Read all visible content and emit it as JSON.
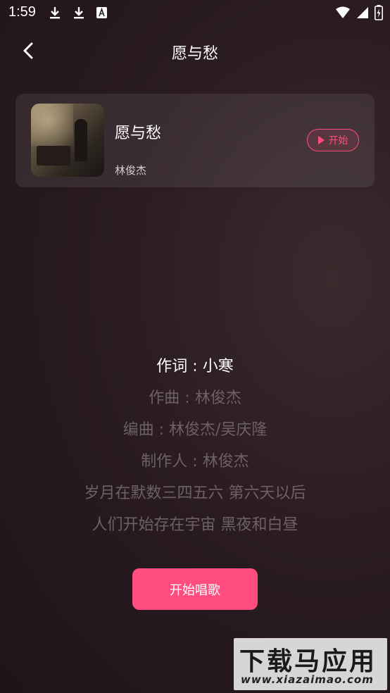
{
  "status_bar": {
    "time": "1:59",
    "left_icons": [
      "download-icon",
      "download-icon",
      "font-icon"
    ],
    "right_icons": [
      "wifi-icon",
      "signal-icon",
      "battery-icon"
    ]
  },
  "header": {
    "title": "愿与愁"
  },
  "song": {
    "title": "愿与愁",
    "artist": "林俊杰",
    "start_label": "开始"
  },
  "lyrics": [
    "作词 : 小寒",
    "作曲 : 林俊杰",
    "编曲 : 林俊杰/吴庆隆",
    "制作人 : 林俊杰",
    "岁月在默数三四五六 第六天以后",
    "人们开始存在宇宙 黑夜和白昼"
  ],
  "active_lyric_index": 0,
  "sing_button_label": "开始唱歌",
  "watermark": {
    "main": "下载马应用",
    "sub": "www.xiazaimao.com"
  },
  "colors": {
    "accent": "#ff4d80",
    "background": "#2a1c20",
    "lyric_inactive": "#6d6068"
  }
}
